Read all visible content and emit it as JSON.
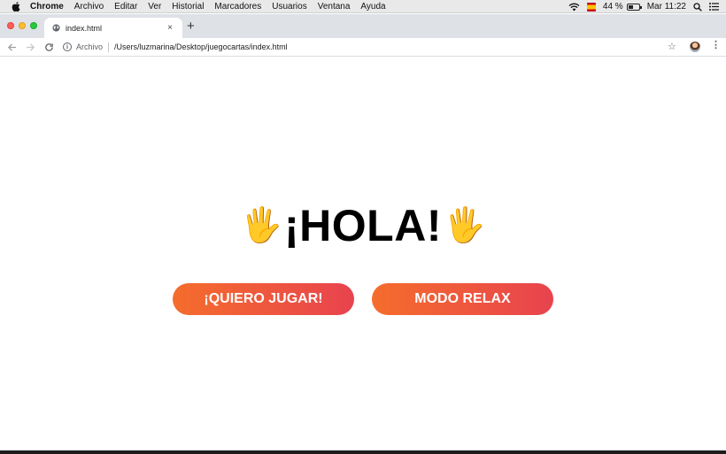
{
  "menubar": {
    "app_name": "Chrome",
    "items": [
      "Archivo",
      "Editar",
      "Ver",
      "Historial",
      "Marcadores",
      "Usuarios",
      "Ventana",
      "Ayuda"
    ],
    "battery_percent": "44 %",
    "clock": "Mar 11:22",
    "icons": [
      "apple-icon",
      "wifi-icon",
      "keyboard-flag-icon",
      "battery-icon",
      "spotlight-search-icon",
      "notification-center-icon"
    ]
  },
  "tab": {
    "title": "index.html",
    "close_glyph": "×"
  },
  "newtab_glyph": "+",
  "toolbar": {
    "scheme_label": "Archivo",
    "url": "/Users/luzmarina/Desktop/juegocartas/index.html"
  },
  "page": {
    "left_emoji": "🖐",
    "heading": "¡HOLA!",
    "right_emoji": "🖐",
    "play_button": "¡QUIERO JUGAR!",
    "relax_button": "MODO RELAX"
  },
  "colors": {
    "button_gradient_start": "#f56d2c",
    "button_gradient_end": "#e8434e"
  }
}
